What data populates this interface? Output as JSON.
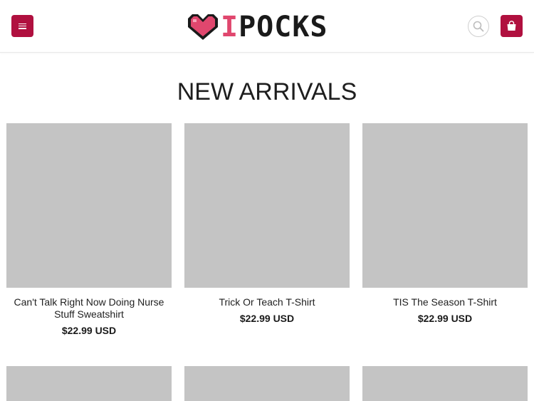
{
  "header": {
    "logo_text_accent": "I",
    "logo_text_main": "POCKS",
    "brand_color": "#b0103f",
    "logo_accent_color": "#e0476e",
    "menu_icon": "hamburger-icon",
    "search_icon": "search-icon",
    "cart_icon": "shopping-bag-icon"
  },
  "main": {
    "section_title": "NEW ARRIVALS",
    "products": [
      {
        "name": "Can't Talk Right Now Doing Nurse Stuff Sweatshirt",
        "price": "$22.99 USD"
      },
      {
        "name": "Trick Or Teach T-Shirt",
        "price": "$22.99 USD"
      },
      {
        "name": "TIS The Season T-Shirt",
        "price": "$22.99 USD"
      }
    ]
  }
}
